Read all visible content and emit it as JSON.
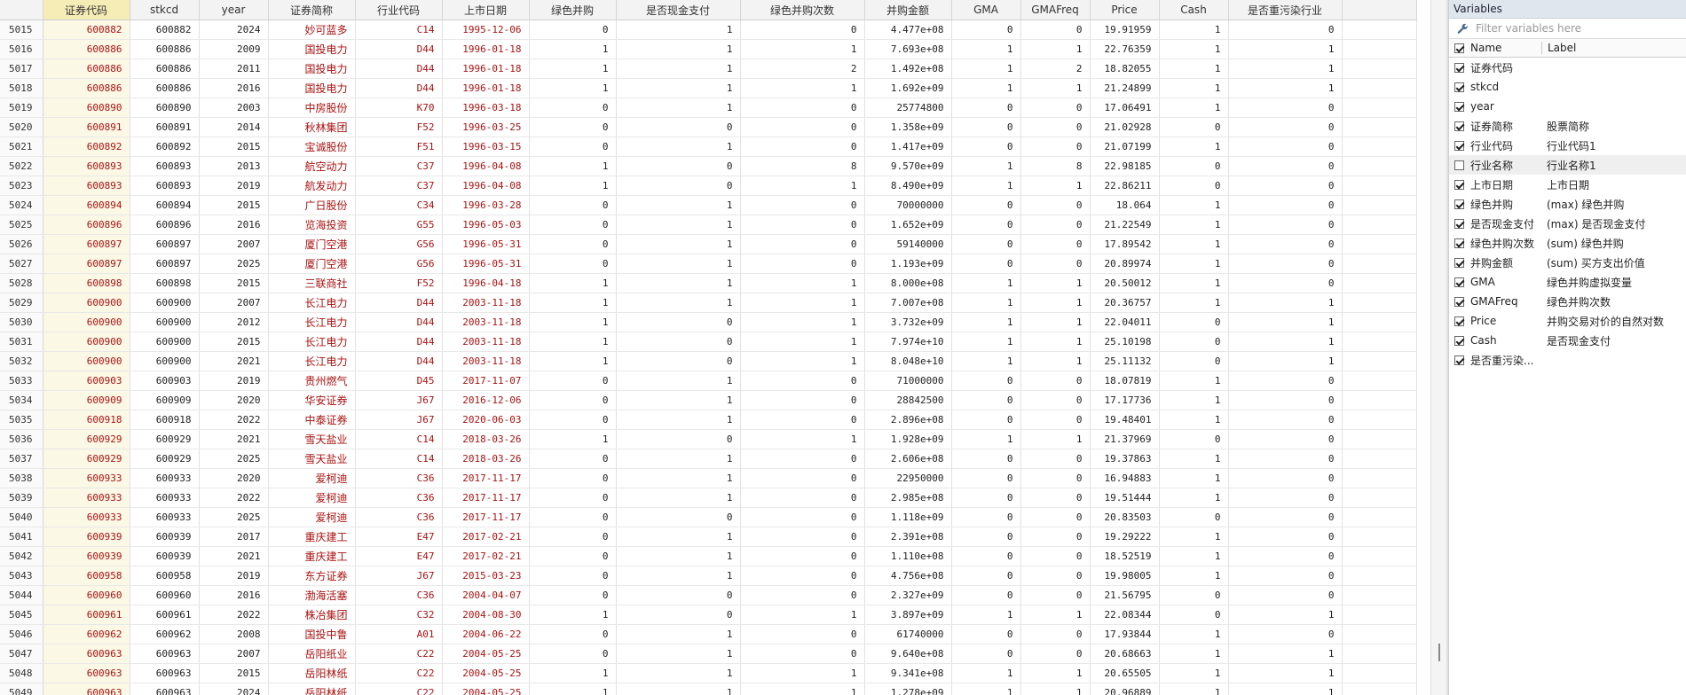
{
  "columns": [
    "证券代码",
    "stkcd",
    "year",
    "证券简称",
    "行业代码",
    "上市日期",
    "绿色并购",
    "是否现金支付",
    "绿色并购次数",
    "并购金额",
    "GMA",
    "GMAFreq",
    "Price",
    "Cash",
    "是否重污染行业"
  ],
  "rows": [
    [
      "5015",
      "600882",
      "600882",
      "2024",
      "妙可蓝多",
      "C14",
      "1995-12-06",
      "0",
      "1",
      "0",
      "4.477e+08",
      "0",
      "0",
      "19.91959",
      "1",
      "0"
    ],
    [
      "5016",
      "600886",
      "600886",
      "2009",
      "国投电力",
      "D44",
      "1996-01-18",
      "1",
      "1",
      "1",
      "7.693e+08",
      "1",
      "1",
      "22.76359",
      "1",
      "1"
    ],
    [
      "5017",
      "600886",
      "600886",
      "2011",
      "国投电力",
      "D44",
      "1996-01-18",
      "1",
      "1",
      "2",
      "1.492e+08",
      "1",
      "2",
      "18.82055",
      "1",
      "1"
    ],
    [
      "5018",
      "600886",
      "600886",
      "2016",
      "国投电力",
      "D44",
      "1996-01-18",
      "1",
      "1",
      "1",
      "1.692e+09",
      "1",
      "1",
      "21.24899",
      "1",
      "1"
    ],
    [
      "5019",
      "600890",
      "600890",
      "2003",
      "中房股份",
      "K70",
      "1996-03-18",
      "0",
      "1",
      "0",
      "25774800",
      "0",
      "0",
      "17.06491",
      "1",
      "0"
    ],
    [
      "5020",
      "600891",
      "600891",
      "2014",
      "秋林集团",
      "F52",
      "1996-03-25",
      "0",
      "0",
      "0",
      "1.358e+09",
      "0",
      "0",
      "21.02928",
      "0",
      "0"
    ],
    [
      "5021",
      "600892",
      "600892",
      "2015",
      "宝诚股份",
      "F51",
      "1996-03-15",
      "0",
      "1",
      "0",
      "1.417e+09",
      "0",
      "0",
      "21.07199",
      "1",
      "0"
    ],
    [
      "5022",
      "600893",
      "600893",
      "2013",
      "航空动力",
      "C37",
      "1996-04-08",
      "1",
      "0",
      "8",
      "9.570e+09",
      "1",
      "8",
      "22.98185",
      "0",
      "0"
    ],
    [
      "5023",
      "600893",
      "600893",
      "2019",
      "航发动力",
      "C37",
      "1996-04-08",
      "1",
      "0",
      "1",
      "8.490e+09",
      "1",
      "1",
      "22.86211",
      "0",
      "0"
    ],
    [
      "5024",
      "600894",
      "600894",
      "2015",
      "广日股份",
      "C34",
      "1996-03-28",
      "0",
      "1",
      "0",
      "70000000",
      "0",
      "0",
      "18.064",
      "1",
      "0"
    ],
    [
      "5025",
      "600896",
      "600896",
      "2016",
      "览海投资",
      "G55",
      "1996-05-03",
      "0",
      "1",
      "0",
      "1.652e+09",
      "0",
      "0",
      "21.22549",
      "1",
      "0"
    ],
    [
      "5026",
      "600897",
      "600897",
      "2007",
      "厦门空港",
      "G56",
      "1996-05-31",
      "0",
      "1",
      "0",
      "59140000",
      "0",
      "0",
      "17.89542",
      "1",
      "0"
    ],
    [
      "5027",
      "600897",
      "600897",
      "2025",
      "厦门空港",
      "G56",
      "1996-05-31",
      "0",
      "1",
      "0",
      "1.193e+09",
      "0",
      "0",
      "20.89974",
      "1",
      "0"
    ],
    [
      "5028",
      "600898",
      "600898",
      "2015",
      "三联商社",
      "F52",
      "1996-04-18",
      "1",
      "1",
      "1",
      "8.000e+08",
      "1",
      "1",
      "20.50012",
      "1",
      "0"
    ],
    [
      "5029",
      "600900",
      "600900",
      "2007",
      "长江电力",
      "D44",
      "2003-11-18",
      "1",
      "1",
      "1",
      "7.007e+08",
      "1",
      "1",
      "20.36757",
      "1",
      "1"
    ],
    [
      "5030",
      "600900",
      "600900",
      "2012",
      "长江电力",
      "D44",
      "2003-11-18",
      "1",
      "0",
      "1",
      "3.732e+09",
      "1",
      "1",
      "22.04011",
      "0",
      "1"
    ],
    [
      "5031",
      "600900",
      "600900",
      "2015",
      "长江电力",
      "D44",
      "2003-11-18",
      "1",
      "0",
      "1",
      "7.974e+10",
      "1",
      "1",
      "25.10198",
      "0",
      "1"
    ],
    [
      "5032",
      "600900",
      "600900",
      "2021",
      "长江电力",
      "D44",
      "2003-11-18",
      "1",
      "0",
      "1",
      "8.048e+10",
      "1",
      "1",
      "25.11132",
      "0",
      "1"
    ],
    [
      "5033",
      "600903",
      "600903",
      "2019",
      "贵州燃气",
      "D45",
      "2017-11-07",
      "0",
      "1",
      "0",
      "71000000",
      "0",
      "0",
      "18.07819",
      "1",
      "0"
    ],
    [
      "5034",
      "600909",
      "600909",
      "2020",
      "华安证券",
      "J67",
      "2016-12-06",
      "0",
      "1",
      "0",
      "28842500",
      "0",
      "0",
      "17.17736",
      "1",
      "0"
    ],
    [
      "5035",
      "600918",
      "600918",
      "2022",
      "中泰证券",
      "J67",
      "2020-06-03",
      "0",
      "1",
      "0",
      "2.896e+08",
      "0",
      "0",
      "19.48401",
      "1",
      "0"
    ],
    [
      "5036",
      "600929",
      "600929",
      "2021",
      "雪天盐业",
      "C14",
      "2018-03-26",
      "1",
      "0",
      "1",
      "1.928e+09",
      "1",
      "1",
      "21.37969",
      "0",
      "0"
    ],
    [
      "5037",
      "600929",
      "600929",
      "2025",
      "雪天盐业",
      "C14",
      "2018-03-26",
      "0",
      "1",
      "0",
      "2.606e+08",
      "0",
      "0",
      "19.37863",
      "1",
      "0"
    ],
    [
      "5038",
      "600933",
      "600933",
      "2020",
      "爱柯迪",
      "C36",
      "2017-11-17",
      "0",
      "1",
      "0",
      "22950000",
      "0",
      "0",
      "16.94883",
      "1",
      "0"
    ],
    [
      "5039",
      "600933",
      "600933",
      "2022",
      "爱柯迪",
      "C36",
      "2017-11-17",
      "0",
      "1",
      "0",
      "2.985e+08",
      "0",
      "0",
      "19.51444",
      "1",
      "0"
    ],
    [
      "5040",
      "600933",
      "600933",
      "2025",
      "爱柯迪",
      "C36",
      "2017-11-17",
      "0",
      "0",
      "0",
      "1.118e+09",
      "0",
      "0",
      "20.83503",
      "0",
      "0"
    ],
    [
      "5041",
      "600939",
      "600939",
      "2017",
      "重庆建工",
      "E47",
      "2017-02-21",
      "0",
      "1",
      "0",
      "2.391e+08",
      "0",
      "0",
      "19.29222",
      "1",
      "0"
    ],
    [
      "5042",
      "600939",
      "600939",
      "2021",
      "重庆建工",
      "E47",
      "2017-02-21",
      "0",
      "1",
      "0",
      "1.110e+08",
      "0",
      "0",
      "18.52519",
      "1",
      "0"
    ],
    [
      "5043",
      "600958",
      "600958",
      "2019",
      "东方证券",
      "J67",
      "2015-03-23",
      "0",
      "1",
      "0",
      "4.756e+08",
      "0",
      "0",
      "19.98005",
      "1",
      "0"
    ],
    [
      "5044",
      "600960",
      "600960",
      "2016",
      "渤海活塞",
      "C36",
      "2004-04-07",
      "0",
      "0",
      "0",
      "2.327e+09",
      "0",
      "0",
      "21.56795",
      "0",
      "0"
    ],
    [
      "5045",
      "600961",
      "600961",
      "2022",
      "株冶集团",
      "C32",
      "2004-08-30",
      "1",
      "0",
      "1",
      "3.897e+09",
      "1",
      "1",
      "22.08344",
      "0",
      "1"
    ],
    [
      "5046",
      "600962",
      "600962",
      "2008",
      "国投中鲁",
      "A01",
      "2004-06-22",
      "0",
      "1",
      "0",
      "61740000",
      "0",
      "0",
      "17.93844",
      "1",
      "0"
    ],
    [
      "5047",
      "600963",
      "600963",
      "2007",
      "岳阳纸业",
      "C22",
      "2004-05-25",
      "0",
      "1",
      "0",
      "9.640e+08",
      "0",
      "0",
      "20.68663",
      "1",
      "1"
    ],
    [
      "5048",
      "600963",
      "600963",
      "2015",
      "岳阳林纸",
      "C22",
      "2004-05-25",
      "1",
      "1",
      "1",
      "9.341e+08",
      "1",
      "1",
      "20.65505",
      "1",
      "1"
    ],
    [
      "5049",
      "600963",
      "600963",
      "2024",
      "岳阳林纸",
      "C22",
      "2004-05-25",
      "1",
      "1",
      "1",
      "1.278e+09",
      "1",
      "1",
      "20.96889",
      "1",
      "1"
    ]
  ],
  "panel": {
    "title": "Variables",
    "filter_placeholder": "Filter variables here",
    "col_name": "Name",
    "col_label": "Label",
    "vars": [
      {
        "name": "证券代码",
        "label": "",
        "checked": true
      },
      {
        "name": "stkcd",
        "label": "",
        "checked": true
      },
      {
        "name": "year",
        "label": "",
        "checked": true
      },
      {
        "name": "证券简称",
        "label": "股票简称",
        "checked": true
      },
      {
        "name": "行业代码",
        "label": "行业代码1",
        "checked": true
      },
      {
        "name": "行业名称",
        "label": "行业名称1",
        "checked": false
      },
      {
        "name": "上市日期",
        "label": "上市日期",
        "checked": true
      },
      {
        "name": "绿色并购",
        "label": "(max) 绿色并购",
        "checked": true
      },
      {
        "name": "是否现金支付",
        "label": "(max) 是否现金支付",
        "checked": true
      },
      {
        "name": "绿色并购次数",
        "label": "(sum) 绿色并购",
        "checked": true
      },
      {
        "name": "并购金额",
        "label": "(sum) 买方支出价值",
        "checked": true
      },
      {
        "name": "GMA",
        "label": "绿色并购虚拟变量",
        "checked": true
      },
      {
        "name": "GMAFreq",
        "label": "绿色并购次数",
        "checked": true
      },
      {
        "name": "Price",
        "label": "并购交易对价的自然对数",
        "checked": true
      },
      {
        "name": "Cash",
        "label": "是否现金支付",
        "checked": true
      },
      {
        "name": "是否重污染...",
        "label": "",
        "checked": true
      }
    ]
  }
}
